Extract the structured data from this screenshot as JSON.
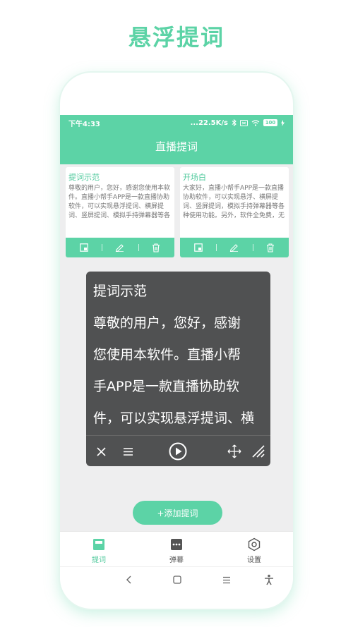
{
  "promo": {
    "title": "悬浮提词"
  },
  "status_bar": {
    "time": "下午4:33",
    "network": "...22.5K/s",
    "battery": "100"
  },
  "header": {
    "title": "直播提词"
  },
  "cards": [
    {
      "title": "提词示范",
      "body": "尊敬的用户，您好，感谢您使用本软件。直播小帮手APP是一款直播协助软件，可以实现悬浮提词、横屏提词、竖屏提词、模拟手持弹幕器等各"
    },
    {
      "title": "开场白",
      "body": "大家好，直播小帮手APP是一款直播协助软件，可以实现悬浮、横屏提词、竖屏提词，模拟手持弹幕器等各种使用功能。另外，软件全免费，无"
    }
  ],
  "float_window": {
    "title": "提词示范",
    "lines": [
      "尊敬的用户，您好，感谢",
      "您使用本软件。直播小帮",
      "手APP是一款直播协助软",
      "件，可以实现悬浮提词、横"
    ]
  },
  "add_button": {
    "label": "+添加提词"
  },
  "tabs": [
    {
      "label": "提词",
      "icon": "document-icon",
      "active": true
    },
    {
      "label": "弹幕",
      "icon": "chat-icon",
      "active": false
    },
    {
      "label": "设置",
      "icon": "settings-icon",
      "active": false
    }
  ],
  "colors": {
    "accent": "#5cd3a6",
    "float_bg": "#505152",
    "screen_bg": "#eeeeef"
  }
}
